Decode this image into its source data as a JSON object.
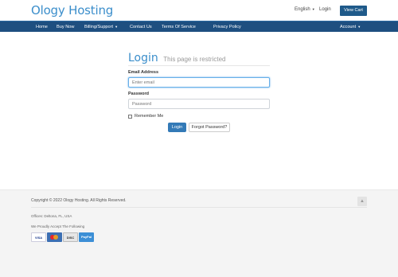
{
  "header": {
    "logo": "Ology Hosting",
    "language": "English",
    "login": "Login",
    "view_cart": "View Cart"
  },
  "nav": {
    "items": [
      "Home",
      "Buy Now",
      "Billing/Support",
      "Contact Us",
      "Terms Of Service",
      "Privacy Policy"
    ],
    "account": "Account"
  },
  "login_form": {
    "title": "Login",
    "subtitle": "This page is restricted",
    "email_label": "Email Address",
    "email_placeholder": "Enter email",
    "password_label": "Password",
    "password_placeholder": "Password",
    "remember_label": "Remember Me",
    "login_button": "Login",
    "forgot_button": "Forgot Password?"
  },
  "footer": {
    "copyright": "Copyright © 2022 Ology Hosting. All Rights Reserved.",
    "offices": "Offices: Deltona, FL, USA",
    "accept": "We Proudly Accept The Following",
    "cards": [
      "VISA",
      "MC",
      "DISCOVER",
      "PayPal"
    ]
  },
  "colors": {
    "brand": "#3b8ecb",
    "navbar": "#1e4f80",
    "cart_button": "#1f5a8a",
    "primary_button": "#337ab7"
  }
}
